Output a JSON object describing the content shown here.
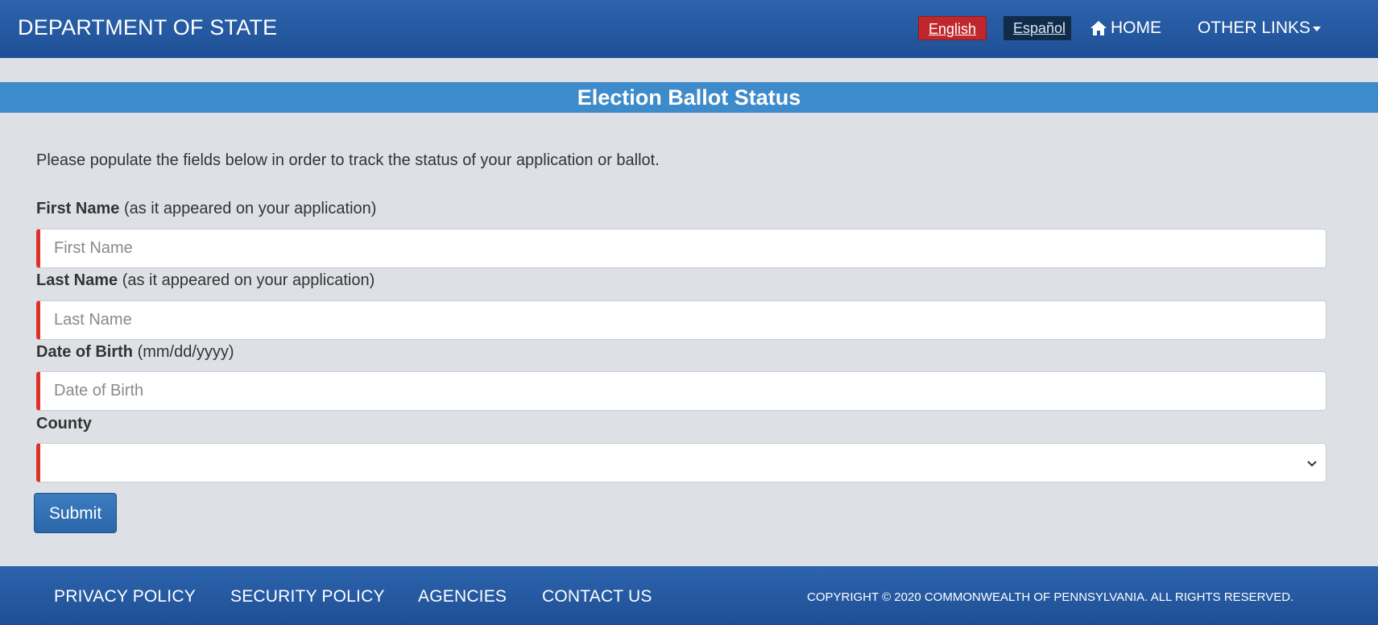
{
  "header": {
    "brand": "DEPARTMENT OF STATE",
    "lang_english": "English",
    "lang_spanish": "Español",
    "home_label": "HOME",
    "other_links_label": "OTHER LINKS"
  },
  "title_bar": {
    "title": "Election Ballot Status"
  },
  "form": {
    "intro": "Please populate the fields below in order to track the status of your application or ballot.",
    "first_name": {
      "label": "First Name",
      "hint": "(as it appeared on your application)",
      "placeholder": "First Name",
      "value": ""
    },
    "last_name": {
      "label": "Last Name",
      "hint": "(as it appeared on your application)",
      "placeholder": "Last Name",
      "value": ""
    },
    "dob": {
      "label": "Date of Birth",
      "hint": "(mm/dd/yyyy)",
      "placeholder": "Date of Birth",
      "value": ""
    },
    "county": {
      "label": "County",
      "selected": ""
    },
    "submit_label": "Submit"
  },
  "footer": {
    "privacy": "PRIVACY POLICY",
    "security": "SECURITY POLICY",
    "agencies": "AGENCIES",
    "contact": "CONTACT US",
    "copyright": "COPYRIGHT © 2020 COMMONWEALTH OF PENNSYLVANIA. ALL RIGHTS RESERVED."
  },
  "colors": {
    "header_blue": "#1f4f96",
    "title_blue": "#3e8bcb",
    "english_red": "#c0272d",
    "spanish_navy": "#102c4a",
    "required_red": "#e0302a",
    "background": "#dde1e6"
  }
}
